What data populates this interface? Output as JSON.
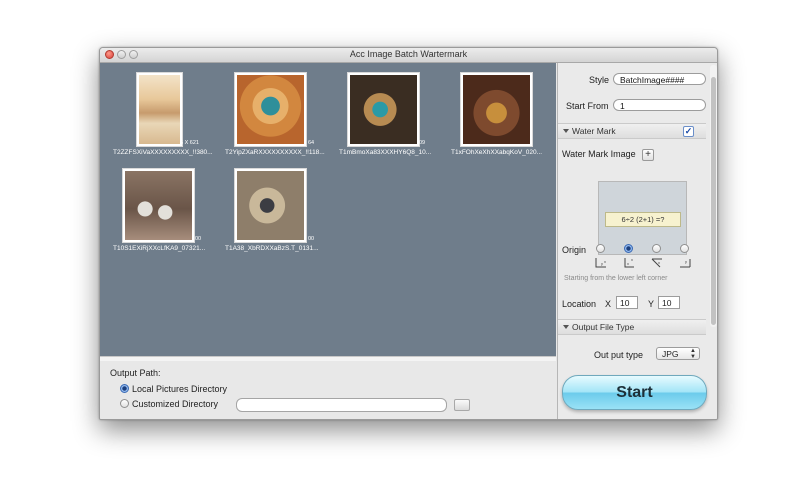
{
  "window": {
    "title": "Acc Image Batch Wartermark"
  },
  "thumbnails": [
    {
      "caption": "T2ZZFSXiVaXXXXXXXXX_!!380...",
      "dims": "5 X 621",
      "colors": [
        "#e8c89a",
        "#c79b6d",
        "#f3e3c8"
      ]
    },
    {
      "caption": "T2YipZXaRXXXXXXXXXX_!!118...",
      "dims": "64",
      "colors": [
        "#d2873f",
        "#2f8f9a",
        "#e7b06a"
      ]
    },
    {
      "caption": "T1mBmoXa83XXXHY6Q8_10...",
      "dims": "09",
      "colors": [
        "#3a2d22",
        "#2a9aa6",
        "#b78b52"
      ]
    },
    {
      "caption": "T1xFOhXeXhXXabqKoV_020...",
      "dims": "",
      "colors": [
        "#4c2a1b",
        "#c78f3c",
        "#7e4a2e"
      ]
    },
    {
      "caption": "T10S1EXiRjXXcLfKA9_07321...",
      "dims": "00",
      "colors": [
        "#6a5548",
        "#e3e0da",
        "#a78d7c"
      ]
    },
    {
      "caption": "T1A38_XbRDXXaBzS.T_0131...",
      "dims": "00",
      "colors": [
        "#8e7e6a",
        "#3c3d43",
        "#c9b89a"
      ]
    }
  ],
  "settings": {
    "style_label": "Style",
    "style_value": "BatchImage####",
    "start_from_label": "Start From",
    "start_from_value": "1",
    "watermark_section": "Water Mark",
    "watermark_enabled": true,
    "watermark_image_label": "Water Mark Image",
    "watermark_preview_text": "6÷2 (2+1) =?",
    "origin_label": "Origin",
    "origin_options": [
      "lower-left",
      "lower-right-selected",
      "upper-left",
      "upper-right"
    ],
    "origin_selected_index": 1,
    "origin_hint": "Starting from the lower left corner",
    "location_label": "Location",
    "x_label": "X",
    "x_value": "10",
    "y_label": "Y",
    "y_value": "10",
    "output_type_section": "Output File Type",
    "output_type_label": "Out put type",
    "output_type_value": "JPG"
  },
  "output": {
    "path_label": "Output Path:",
    "option_local": "Local Pictures Directory",
    "option_custom": "Customized Directory",
    "selected": "local",
    "custom_path": ""
  },
  "start_button": "Start",
  "colors": {
    "gallery_bg": "#6f7d8b",
    "start_button": "#8fdcf3",
    "accent": "#3a6ab4"
  }
}
